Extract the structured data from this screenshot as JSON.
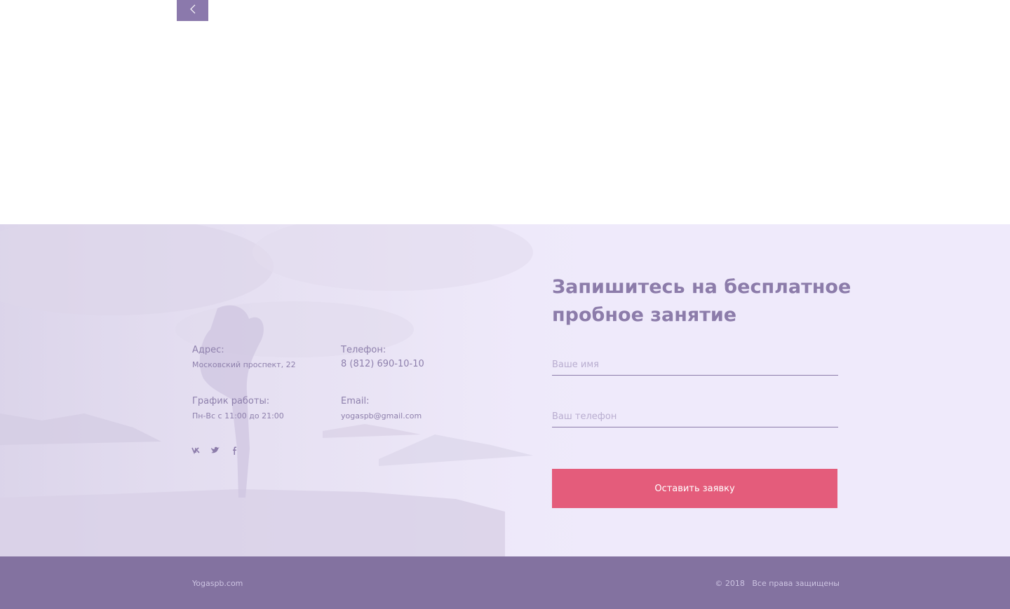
{
  "nav": {
    "back_icon": "chevron-left-icon"
  },
  "contacts": {
    "address_label": "Адрес:",
    "address_value": "Московский проспект, 22",
    "phone_label": "Телефон:",
    "phone_value": "8 (812) 690-10-10",
    "schedule_label": "График работы:",
    "schedule_value": "Пн-Вс с 11:00 до 21:00",
    "email_label": "Email:",
    "email_value": "yogaspb@gmail.com",
    "social": [
      "vk-icon",
      "twitter-icon",
      "facebook-icon"
    ]
  },
  "form": {
    "title": "Запишитесь на бесплатное пробное занятие",
    "name_placeholder": "Ваше имя",
    "phone_placeholder": "Ваш телефон",
    "submit_label": "Оставить заявку"
  },
  "footer": {
    "site": "Yogaspb.com",
    "copyright": "© 2018   Все права защищены"
  },
  "colors": {
    "accent": "#8b79ac",
    "button": "#e45c7b",
    "section_bg": "#efeafb",
    "footer_bg": "#8372a0"
  }
}
